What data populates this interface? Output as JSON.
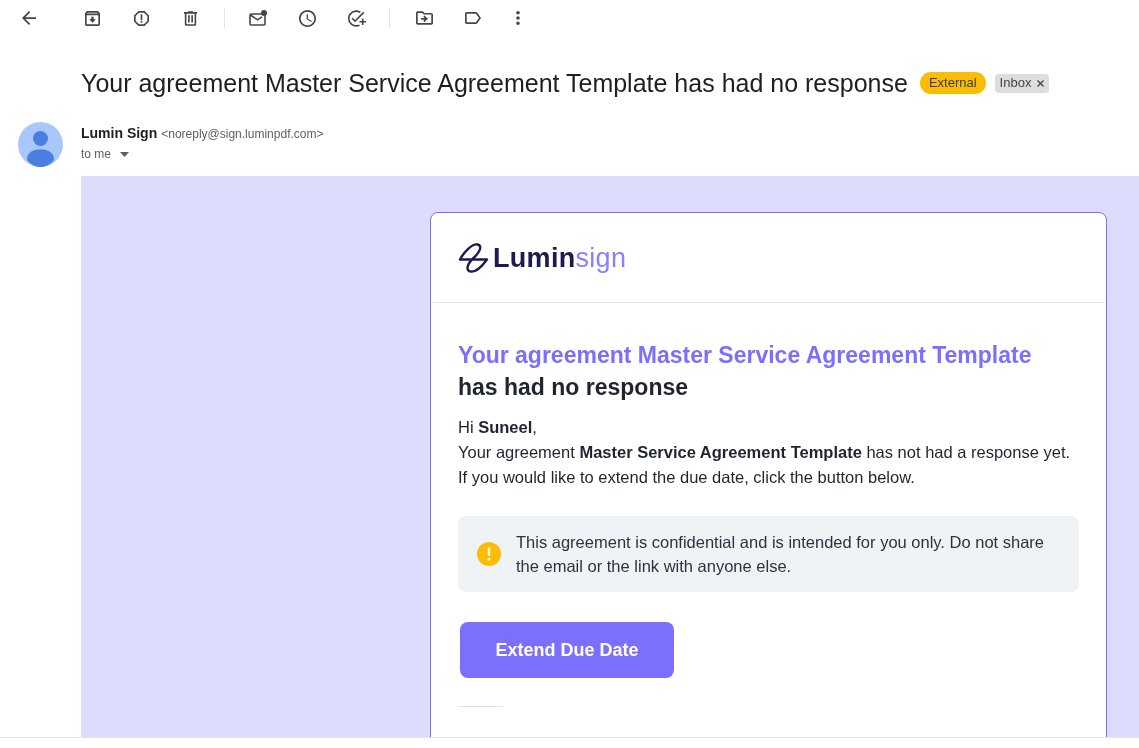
{
  "subject": "Your agreement Master Service Agreement Template has had no response",
  "labels": [
    {
      "text": "External",
      "color": "#fbbc04",
      "removable": false
    },
    {
      "text": "Inbox",
      "color": "#dddddd",
      "removable": true
    }
  ],
  "sender": {
    "name": "Lumin Sign",
    "email": "<noreply@sign.luminpdf.com>",
    "recipient": "to me"
  },
  "message": {
    "logo": {
      "brand": "Lumin",
      "product": "sign"
    },
    "heading": {
      "highlight": "Your agreement Master Service Agreement Template",
      "text": "has had no response"
    },
    "paragraphs": [
      "Hi **Suneel**,",
      "Your agreement **Master Service Agreement Template** has not had a response yet.",
      "If you would like to extend the due date, click the button below."
    ],
    "notice": "This agreement is confidential and is intended for you only. Do not share the email or the link with anyone else.",
    "button": "Extend Due Date"
  }
}
